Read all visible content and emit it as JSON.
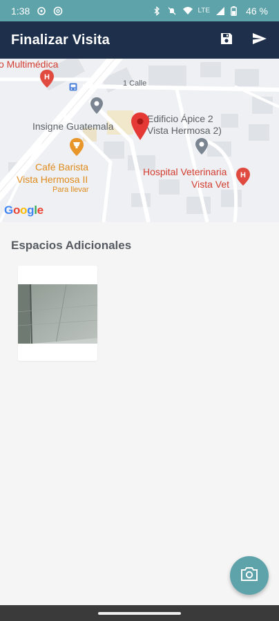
{
  "status_bar": {
    "time": "1:38",
    "lte": "LTE",
    "battery": "46 %",
    "icons": [
      "data-saver-icon",
      "at-icon",
      "bluetooth-icon",
      "mute-icon",
      "wifi-icon",
      "signal-icon",
      "battery-icon"
    ]
  },
  "app_bar": {
    "title": "Finalizar Visita",
    "actions": [
      "save-icon",
      "send-icon"
    ]
  },
  "map": {
    "labels": {
      "multimedica": "o Multimédica",
      "calle": "1 Calle",
      "insigne": "Insigne Guatemala",
      "edificio_line1": "Edificio Ápice 2",
      "edificio_line2": "Vista Hermosa 2)",
      "cafe_line1": "Café Barista",
      "cafe_line2": "Vista Hermosa II",
      "para_llevar": "Para llevar",
      "hospital_line1": "Hospital Veterinaria",
      "hospital_line2": "Vista Vet",
      "google": "Google"
    },
    "colors": {
      "background": "#eef0f3",
      "pin": "#e53935",
      "poi_red": "#d23b2f",
      "poi_orange": "#e08a1c",
      "poi_gray": "#7a8591"
    }
  },
  "section": {
    "title": "Espacios Adicionales"
  },
  "fab": {
    "icon": "camera-icon"
  },
  "colors": {
    "status_bar": "#5fa3aa",
    "app_bar": "#1e2f4b",
    "fab": "#5fa3aa"
  }
}
